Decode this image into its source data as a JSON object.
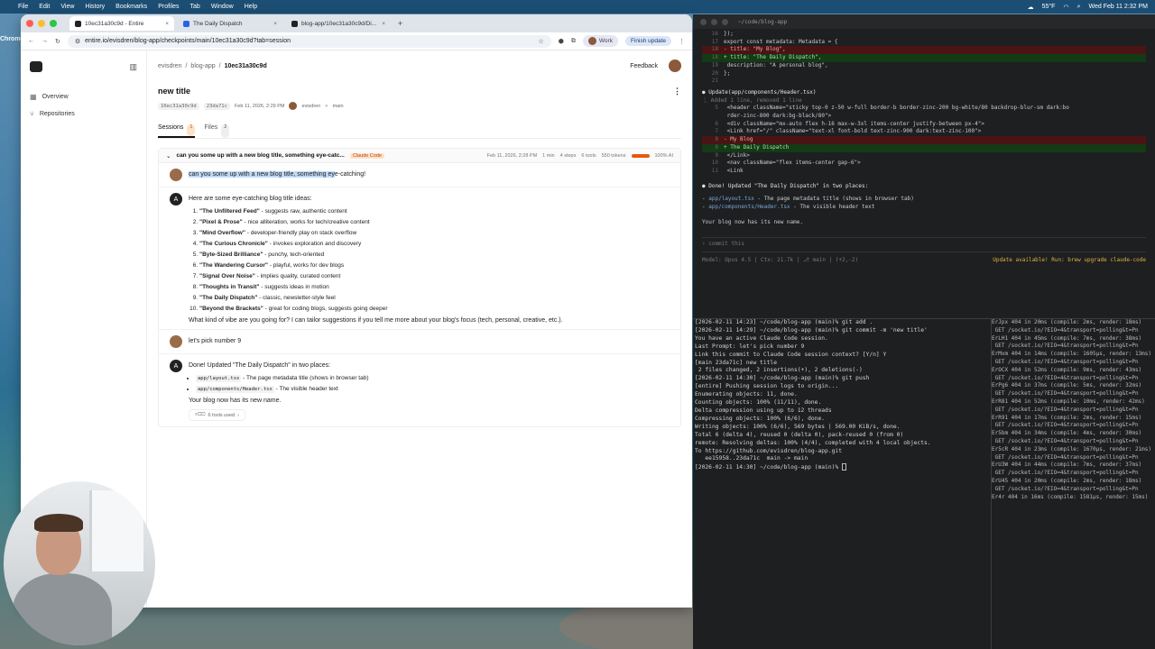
{
  "menubar": {
    "app": "Chrome",
    "items": [
      "File",
      "Edit",
      "View",
      "History",
      "Bookmarks",
      "Profiles",
      "Tab",
      "Window",
      "Help"
    ],
    "weather": "55°F",
    "clock": "Wed Feb 11  2:32 PM"
  },
  "browser": {
    "tabs": [
      {
        "title": "10ec31a30c9d - Entire"
      },
      {
        "title": "The Daily Dispatch"
      },
      {
        "title": "blog-app/10ec31a30c9d/Di..."
      }
    ],
    "url": "entire.io/evisdren/blog-app/checkpoints/main/10ec31a30c9d?tab=session",
    "work_label": "Work",
    "finish_update": "Finish update"
  },
  "sidebar": {
    "items": [
      {
        "label": "Overview"
      },
      {
        "label": "Repositories"
      }
    ]
  },
  "breadcrumb": {
    "org": "evisdren",
    "repo": "blog-app",
    "checkpoint": "10ec31a30c9d"
  },
  "topbar": {
    "feedback": "Feedback"
  },
  "page": {
    "title": "new title",
    "checkpoint_id": "10ec31a30c9d",
    "commit": "23da71c",
    "date": "Feb 11, 2026, 2:29 PM",
    "author": "evisdren",
    "branch": "main"
  },
  "tabs": [
    {
      "label": "Sessions",
      "count": "1"
    },
    {
      "label": "Files",
      "count": "2"
    }
  ],
  "session": {
    "title": "can you some up with a new blog title, something eye-catc...",
    "badge": "Claude Code",
    "date": "Feb 11, 2026, 2:28 PM",
    "duration": "1 min",
    "steps": "4 steps",
    "tools": "6 tools",
    "tokens": "550 tokens",
    "ai_share": "100% AI",
    "ai_fraction": 1.0
  },
  "messages": {
    "user1_highlighted": "can you some up with a new blog title, something ey",
    "user1_rest": "e-catching!",
    "assistant1_intro": "Here are some eye-catching blog title ideas:",
    "ideas": [
      {
        "title": "\"The Unfiltered Feed\"",
        "desc": " - suggests raw, authentic content"
      },
      {
        "title": "\"Pixel & Prose\"",
        "desc": " - nice alliteration, works for tech/creative content"
      },
      {
        "title": "\"Mind Overflow\"",
        "desc": " - developer-friendly play on stack overflow"
      },
      {
        "title": "\"The Curious Chronicle\"",
        "desc": " - invokes exploration and discovery"
      },
      {
        "title": "\"Byte-Sized Brilliance\"",
        "desc": " - punchy, tech-oriented"
      },
      {
        "title": "\"The Wandering Cursor\"",
        "desc": " - playful, works for dev blogs"
      },
      {
        "title": "\"Signal Over Noise\"",
        "desc": " - implies quality, curated content"
      },
      {
        "title": "\"Thoughts in Transit\"",
        "desc": " - suggests ideas in motion"
      },
      {
        "title": "\"The Daily Dispatch\"",
        "desc": " - classic, newsletter-style feel"
      },
      {
        "title": "\"Beyond the Brackets\"",
        "desc": " - great for coding blogs, suggests going deeper"
      }
    ],
    "assistant1_outro": "What kind of vibe are you going for? I can tailor suggestions if you tell me more about your blog's focus (tech, personal, creative, etc.).",
    "user2": "let's pick number 9",
    "assistant2_intro": "Done! Updated \"The Daily Dispatch\" in two places:",
    "places": [
      {
        "file": "app/layout.tsx",
        "desc": " - The page metadata title (shows in browser tab)"
      },
      {
        "file": "app/components/Header.tsx",
        "desc": " - The visible header text"
      }
    ],
    "assistant2_outro": "Your blog now has its new name.",
    "tools_used": "6 tools used"
  },
  "terminal": {
    "title": "~/code/blog-app",
    "diff1": [
      {
        "n": "16",
        "t": "});",
        "k": "ctx"
      },
      {
        "n": "17",
        "t": "export const metadata: Metadata = {",
        "k": "ctx"
      },
      {
        "n": "18",
        "t": "-  title: \"My Blog\",",
        "k": "del"
      },
      {
        "n": "18",
        "t": "+  title: \"The Daily Dispatch\",",
        "k": "add"
      },
      {
        "n": "19",
        "t": "   description: \"A personal blog\",",
        "k": "ctx"
      },
      {
        "n": "20",
        "t": "};",
        "k": "ctx"
      },
      {
        "n": "21",
        "t": "",
        "k": "ctx"
      }
    ],
    "update_head": "Update(app/components/Header.tsx)",
    "update_sub": "⎿  Added 1 line, removed 1 line",
    "diff2": [
      {
        "n": "5",
        "t": "    <header className=\"sticky top-0 z-50 w-full border-b border-zinc-200 bg-white/80 backdrop-blur-sm dark:bo",
        "k": "ctx"
      },
      {
        "n": "",
        "t": "    rder-zinc-800 dark:bg-black/80\">",
        "k": "ctx"
      },
      {
        "n": "6",
        "t": "      <div className=\"mx-auto flex h-16 max-w-3xl items-center justify-between px-4\">",
        "k": "ctx"
      },
      {
        "n": "7",
        "t": "        <Link href=\"/\" className=\"text-xl font-bold text-zinc-900 dark:text-zinc-100\">",
        "k": "ctx"
      },
      {
        "n": "8",
        "t": "-          My Blog",
        "k": "del"
      },
      {
        "n": "8",
        "t": "+          The Daily Dispatch",
        "k": "add"
      },
      {
        "n": "9",
        "t": "        </Link>",
        "k": "ctx"
      },
      {
        "n": "10",
        "t": "        <nav className=\"flex items-center gap-6\">",
        "k": "ctx"
      },
      {
        "n": "11",
        "t": "          <Link",
        "k": "ctx"
      }
    ],
    "done": "● Done! Updated \"The Daily Dispatch\" in two places:",
    "done_items": [
      {
        "file": "app/layout.tsx",
        "desc": " - The page metadata title (shows in browser tab)"
      },
      {
        "file": "app/components/Header.tsx",
        "desc": " - The visible header text"
      }
    ],
    "done_outro": "Your blog now has its new name.",
    "prompt": "› commit this",
    "status_left": "Model: Opus 4.5 | Ctx: 21.7k | ⎇ main | (+2,-2)",
    "status_right": "Update available! Run: brew upgrade claude-code",
    "shell": [
      "[2026-02-11 14:23] ~/code/blog-app (main)% git add .",
      "[2026-02-11 14:29] ~/code/blog-app (main)% git commit -m 'new title'",
      "You have an active Claude Code session.",
      "Last Prompt: let's pick number 9",
      "Link this commit to Claude Code session context? [Y/n] Y",
      "[main 23da71c] new title",
      " 2 files changed, 2 insertions(+), 2 deletions(-)",
      "[2026-02-11 14:30] ~/code/blog-app (main)% git push",
      "[entire] Pushing session logs to origin...",
      "Enumerating objects: 11, done.",
      "Counting objects: 100% (11/11), done.",
      "Delta compression using up to 12 threads",
      "Compressing objects: 100% (6/6), done.",
      "Writing objects: 100% (6/6), 569 bytes | 569.00 KiB/s, done.",
      "Total 6 (delta 4), reused 0 (delta 0), pack-reused 0 (from 0)",
      "remote: Resolving deltas: 100% (4/4), completed with 4 local objects.",
      "To https://github.com/evisdren/blog-app.git",
      "   ee15958..23da71c  main -> main",
      "[2026-02-11 14:30] ~/code/blog-app (main)% "
    ],
    "server_log": [
      "ErJpx 404 in 20ms (compile: 2ms, render: 18ms)",
      " GET /socket.io/?EIO=4&transport=polling&t=Pn",
      "ErLH1 404 in 45ms (compile: 7ms, render: 38ms)",
      " GET /socket.io/?EIO=4&transport=polling&t=Pn",
      "ErMxm 404 in 14ms (compile: 1605µs, render: 13ms)",
      " GET /socket.io/?EIO=4&transport=polling&t=Pn",
      "ErOCX 404 in 52ms (compile: 9ms, render: 43ms)",
      " GET /socket.io/?EIO=4&transport=polling&t=Pn",
      "ErPg6 404 in 37ms (compile: 5ms, render: 32ms)",
      " GET /socket.io/?EIO=4&transport=polling&t=Pn",
      "ErR81 404 in 52ms (compile: 10ms, render: 42ms)",
      " GET /socket.io/?EIO=4&transport=polling&t=Pn",
      "ErR91 404 in 17ms (compile: 2ms, render: 15ms)",
      " GET /socket.io/?EIO=4&transport=polling&t=Pn",
      "Er5bm 404 in 34ms (compile: 4ms, render: 30ms)",
      " GET /socket.io/?EIO=4&transport=polling&t=Pn",
      "Er5cR 404 in 23ms (compile: 1670µs, render: 21ms)",
      " GET /socket.io/?EIO=4&transport=polling&t=Pn",
      "ErU3W 404 in 44ms (compile: 7ms, render: 37ms)",
      " GET /socket.io/?EIO=4&transport=polling&t=Pn",
      "ErU45 404 in 20ms (compile: 2ms, render: 18ms)",
      " GET /socket.io/?EIO=4&transport=polling&t=Pn",
      "Er4r 404 in 16ms (compile: 1581µs, render: 15ms)"
    ]
  }
}
